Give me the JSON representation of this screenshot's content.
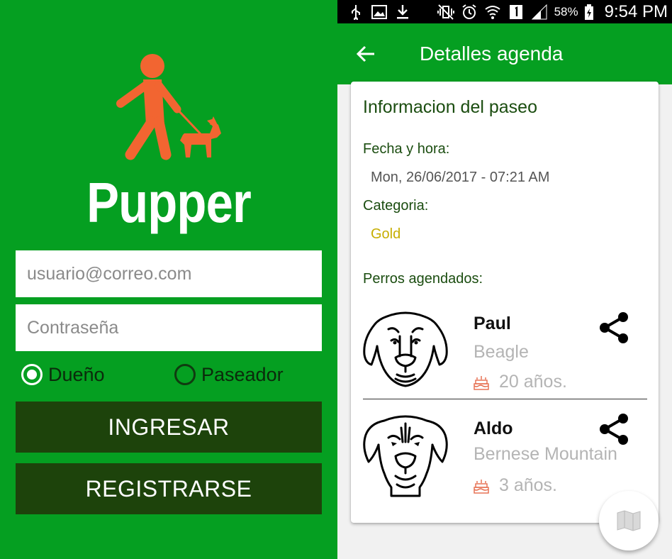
{
  "login": {
    "app_name": "Pupper",
    "email_placeholder": "usuario@correo.com",
    "password_placeholder": "Contraseña",
    "role_options": [
      {
        "label": "Dueño",
        "selected": true
      },
      {
        "label": "Paseador",
        "selected": false
      }
    ],
    "login_label": "INGRESAR",
    "register_label": "REGISTRARSE",
    "logo_icon": "person-walking-dog-icon",
    "colors": {
      "background": "#059f21",
      "button": "#1d430b",
      "logo": "#f26531"
    }
  },
  "status_bar": {
    "icons": [
      "usb-icon",
      "image-icon",
      "download-icon",
      "vibrate-icon",
      "alarm-icon",
      "wifi-icon",
      "sim-1-icon",
      "signal-icon",
      "battery-icon"
    ],
    "battery": "58%",
    "time": "9:54 PM"
  },
  "details": {
    "title": "Detalles agenda",
    "card_title": "Informacion del paseo",
    "date_label": "Fecha y hora:",
    "date_value": "Mon, 26/06/2017 - 07:21 AM",
    "category_label": "Categoria:",
    "category_value": "Gold",
    "dogs_label": "Perros agendados:",
    "dogs": [
      {
        "name": "Paul",
        "breed": "Beagle",
        "age": "20 años.",
        "icon": "beagle-face-icon"
      },
      {
        "name": "Aldo",
        "breed": "Bernese Mountain",
        "age": "3 años.",
        "icon": "bernese-face-icon"
      }
    ],
    "colors": {
      "app_bar": "#059f21",
      "category": "#c6ae00",
      "label": "#1b4d10",
      "secondary_text": "#b4b4b4"
    }
  }
}
